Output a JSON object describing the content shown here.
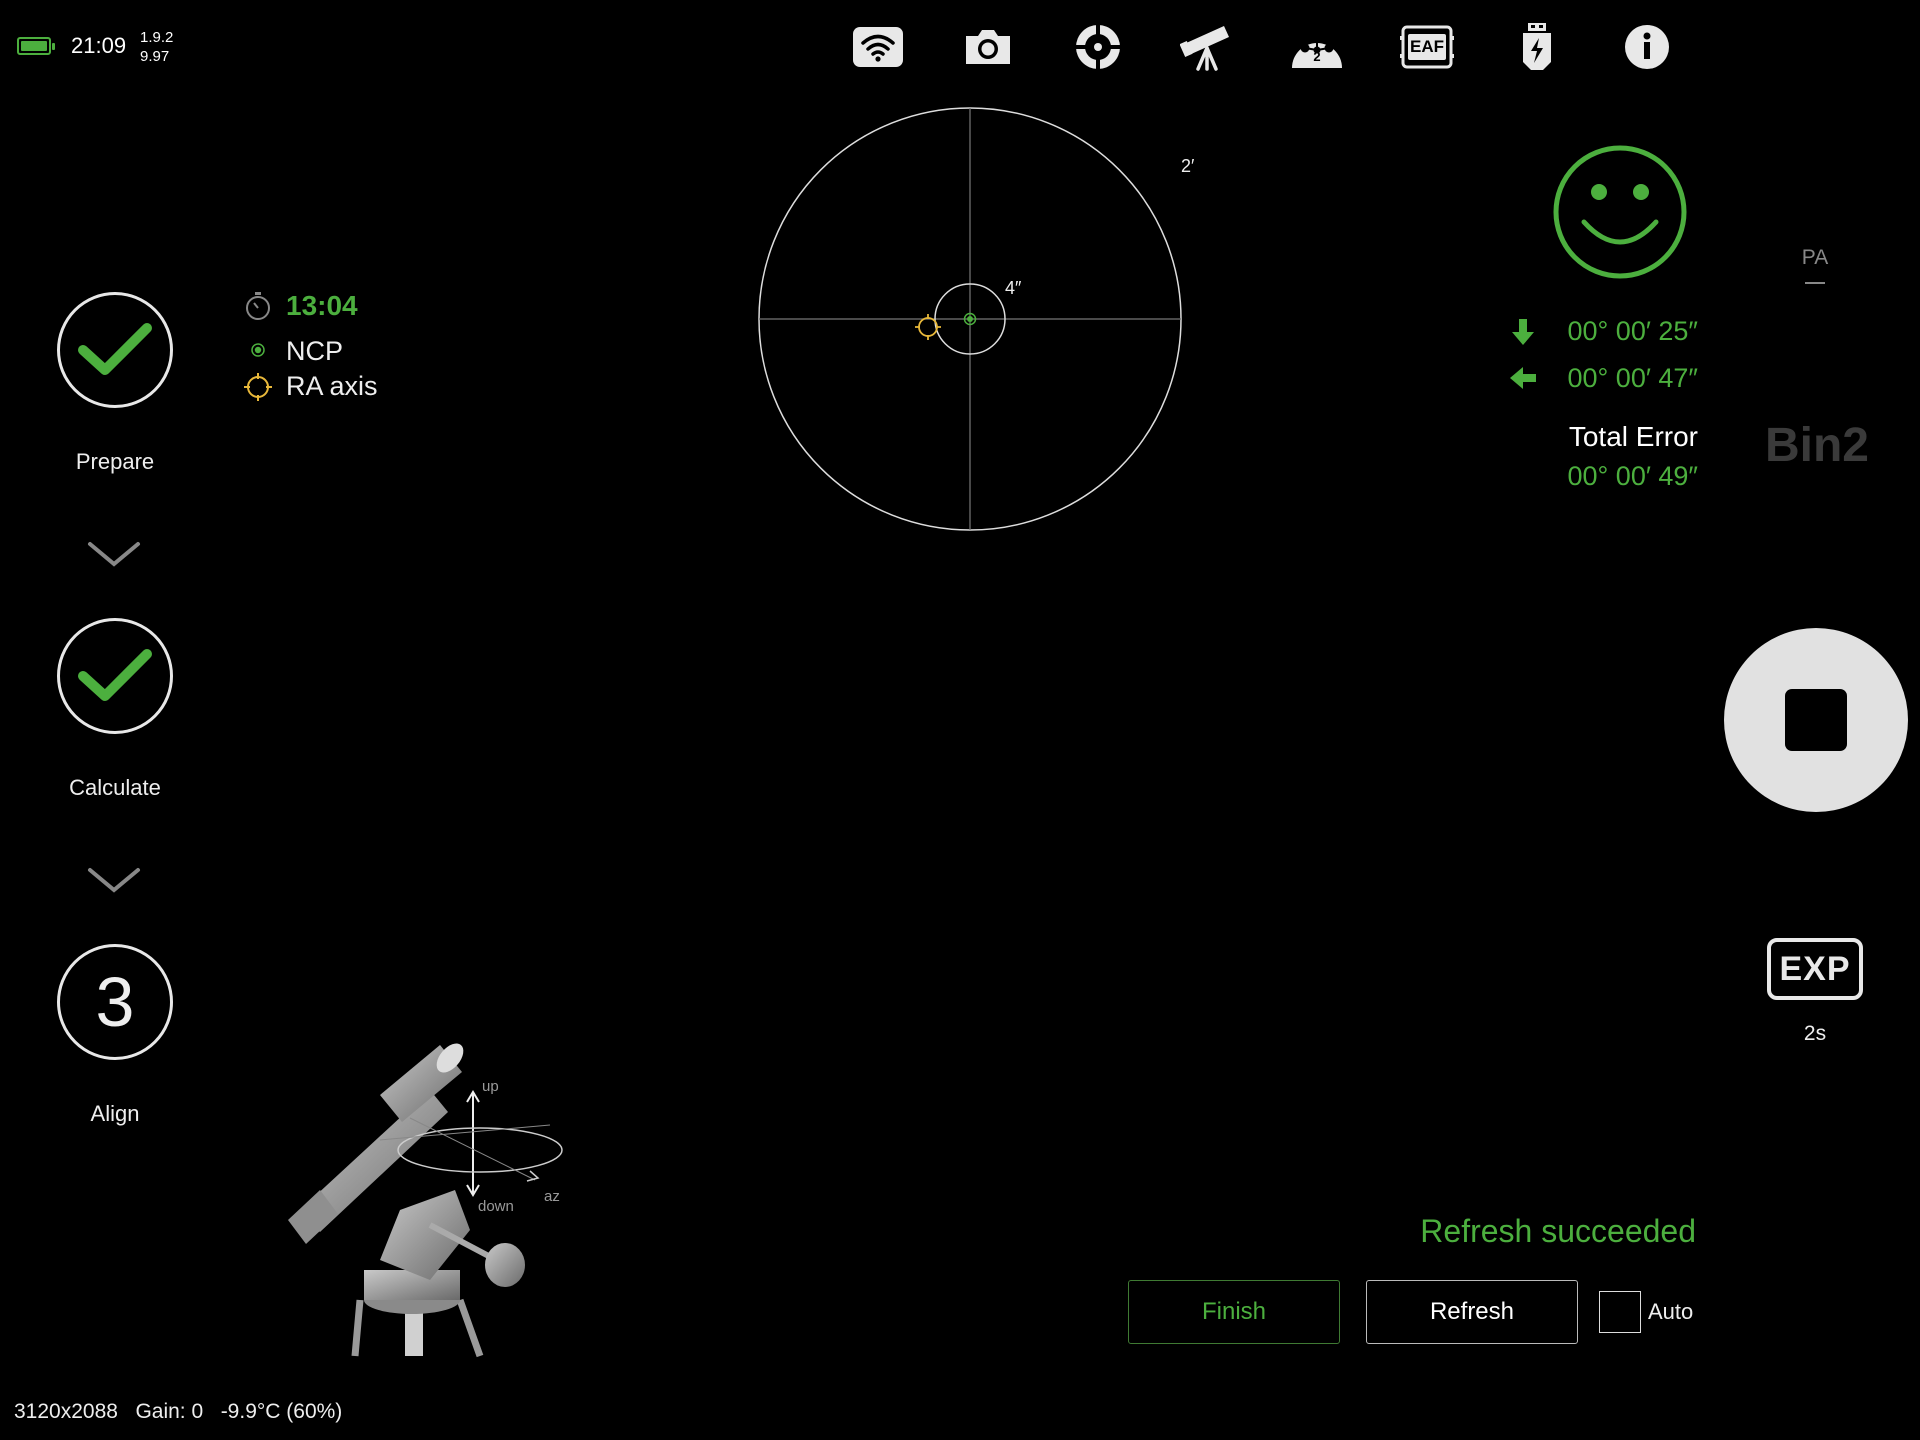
{
  "status": {
    "time": "21:09",
    "version_line1": "1.9.2",
    "version_line2": "9.97",
    "battery_level": 1.0,
    "battery_color": "#4caf3e"
  },
  "toolbar": {
    "items": [
      {
        "icon": "wifi-icon"
      },
      {
        "icon": "camera-icon"
      },
      {
        "icon": "guide-crosshair-icon"
      },
      {
        "icon": "telescope-icon"
      },
      {
        "icon": "filter-wheel-icon",
        "badge": "2"
      },
      {
        "icon": "eaf-focuser-icon",
        "label": "EAF"
      },
      {
        "icon": "usb-power-icon"
      },
      {
        "icon": "info-icon"
      }
    ]
  },
  "steps": [
    {
      "label": "Prepare",
      "state": "done",
      "icon": "checkmark-icon"
    },
    {
      "label": "Calculate",
      "state": "done",
      "icon": "checkmark-icon"
    },
    {
      "label": "Align",
      "state": "current",
      "number": "3"
    }
  ],
  "legend": {
    "timer": "13:04",
    "timer_icon": "stopwatch-icon",
    "items": [
      {
        "label": "NCP",
        "icon": "ncp-dot-icon",
        "color": "#4caf3e"
      },
      {
        "label": "RA axis",
        "icon": "ra-axis-reticle-icon",
        "color": "#e8b83a"
      }
    ]
  },
  "target": {
    "outer_scale": "2′",
    "inner_scale": "4″"
  },
  "result": {
    "status_icon": "smiley-face-icon",
    "alt_error": "00° 00′ 25″",
    "az_error": "00° 00′ 47″",
    "total_label": "Total Error",
    "total_error": "00° 00′ 49″",
    "accent_color": "#4caf3e"
  },
  "side": {
    "mode": "PA",
    "binning": "Bin2",
    "exposure_label": "EXP",
    "exposure_value": "2s"
  },
  "bottom": {
    "message": "Refresh succeeded",
    "finish_label": "Finish",
    "refresh_label": "Refresh",
    "auto_label": "Auto",
    "auto_checked": false
  },
  "mount_diagram": {
    "up_label": "up",
    "down_label": "down",
    "az_label": "az"
  },
  "camera": {
    "resolution": "3120x2088",
    "gain": "Gain: 0",
    "temperature": "-9.9°C (60%)"
  }
}
